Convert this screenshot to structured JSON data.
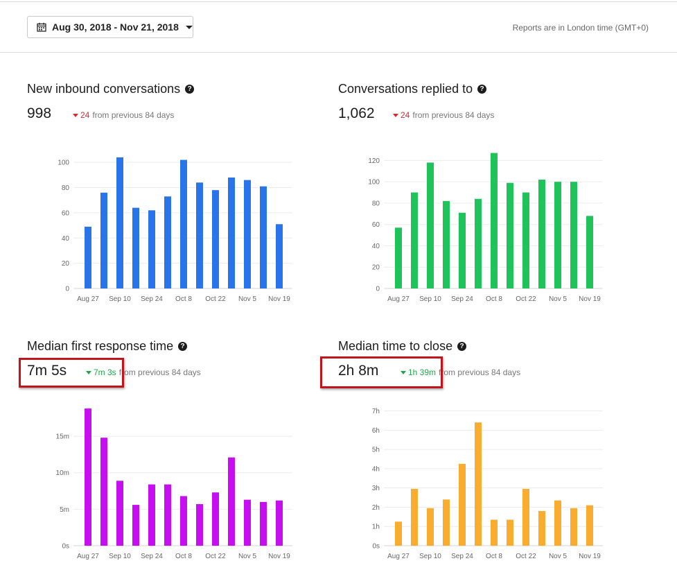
{
  "header": {
    "date_range": "Aug 30, 2018 - Nov 21, 2018",
    "timezone_note": "Reports are in London time (GMT+0)"
  },
  "panels": [
    {
      "title": "New inbound conversations",
      "value": "998",
      "delta_value": "24",
      "delta_text": "from previous 84 days"
    },
    {
      "title": "Conversations replied to",
      "value": "1,062",
      "delta_value": "24",
      "delta_text": "from previous 84 days"
    },
    {
      "title": "Median first response time",
      "value": "7m 5s",
      "delta_value": "7m 3s",
      "delta_text": "from previous 84 days"
    },
    {
      "title": "Median time to close",
      "value": "2h 8m",
      "delta_value": "1h 39m",
      "delta_text": "from previous 84 days"
    }
  ],
  "chart_data": [
    {
      "type": "bar",
      "color": "#2a74ea",
      "x_tick_labels": [
        "Aug 27",
        "Sep 10",
        "Sep 24",
        "Oct 8",
        "Oct 22",
        "Nov 5",
        "Nov 19"
      ],
      "y_ticks": [
        0,
        20,
        40,
        60,
        80,
        100
      ],
      "y_tick_labels": [
        "0",
        "20",
        "40",
        "60",
        "80",
        "100"
      ],
      "ylim": [
        0,
        110
      ],
      "values": [
        49,
        76,
        104,
        64,
        62,
        73,
        102,
        84,
        78,
        88,
        86,
        81,
        51
      ],
      "grid": true
    },
    {
      "type": "bar",
      "color": "#1ec45a",
      "x_tick_labels": [
        "Aug 27",
        "Sep 10",
        "Sep 24",
        "Oct 8",
        "Oct 22",
        "Nov 5",
        "Nov 19"
      ],
      "y_ticks": [
        0,
        20,
        40,
        60,
        80,
        100,
        120
      ],
      "y_tick_labels": [
        "0",
        "20",
        "40",
        "60",
        "80",
        "100",
        "120"
      ],
      "ylim": [
        0,
        130
      ],
      "values": [
        57,
        90,
        118,
        82,
        71,
        84,
        127,
        99,
        90,
        102,
        100,
        100,
        68
      ],
      "grid": true
    },
    {
      "type": "bar",
      "color": "#c70ef0",
      "x_tick_labels": [
        "Aug 27",
        "Sep 10",
        "Sep 24",
        "Oct 8",
        "Oct 22",
        "Nov 5",
        "Nov 19"
      ],
      "y_ticks": [
        0,
        5,
        10,
        15
      ],
      "y_tick_labels": [
        "0s",
        "5m",
        "10m",
        "15m"
      ],
      "y_unit": "minutes",
      "ylim": [
        0,
        19
      ],
      "values": [
        18.8,
        14.8,
        8.9,
        5.6,
        8.4,
        8.4,
        6.8,
        5.7,
        7.3,
        12.1,
        6.3,
        6.0,
        6.2
      ],
      "grid": true
    },
    {
      "type": "bar",
      "color": "#f9ac2e",
      "x_tick_labels": [
        "Aug 27",
        "Sep 10",
        "Sep 24",
        "Oct 8",
        "Oct 22",
        "Nov 5",
        "Nov 19"
      ],
      "y_ticks": [
        0,
        1,
        2,
        3,
        4,
        5,
        6,
        7
      ],
      "y_tick_labels": [
        "0s",
        "1h",
        "2h",
        "3h",
        "4h",
        "5h",
        "6h",
        "7h"
      ],
      "y_unit": "hours",
      "ylim": [
        0,
        7.2
      ],
      "values": [
        1.25,
        2.95,
        1.95,
        2.4,
        4.25,
        6.4,
        1.35,
        1.35,
        2.95,
        1.8,
        2.35,
        1.95,
        2.1
      ],
      "grid": true
    }
  ]
}
